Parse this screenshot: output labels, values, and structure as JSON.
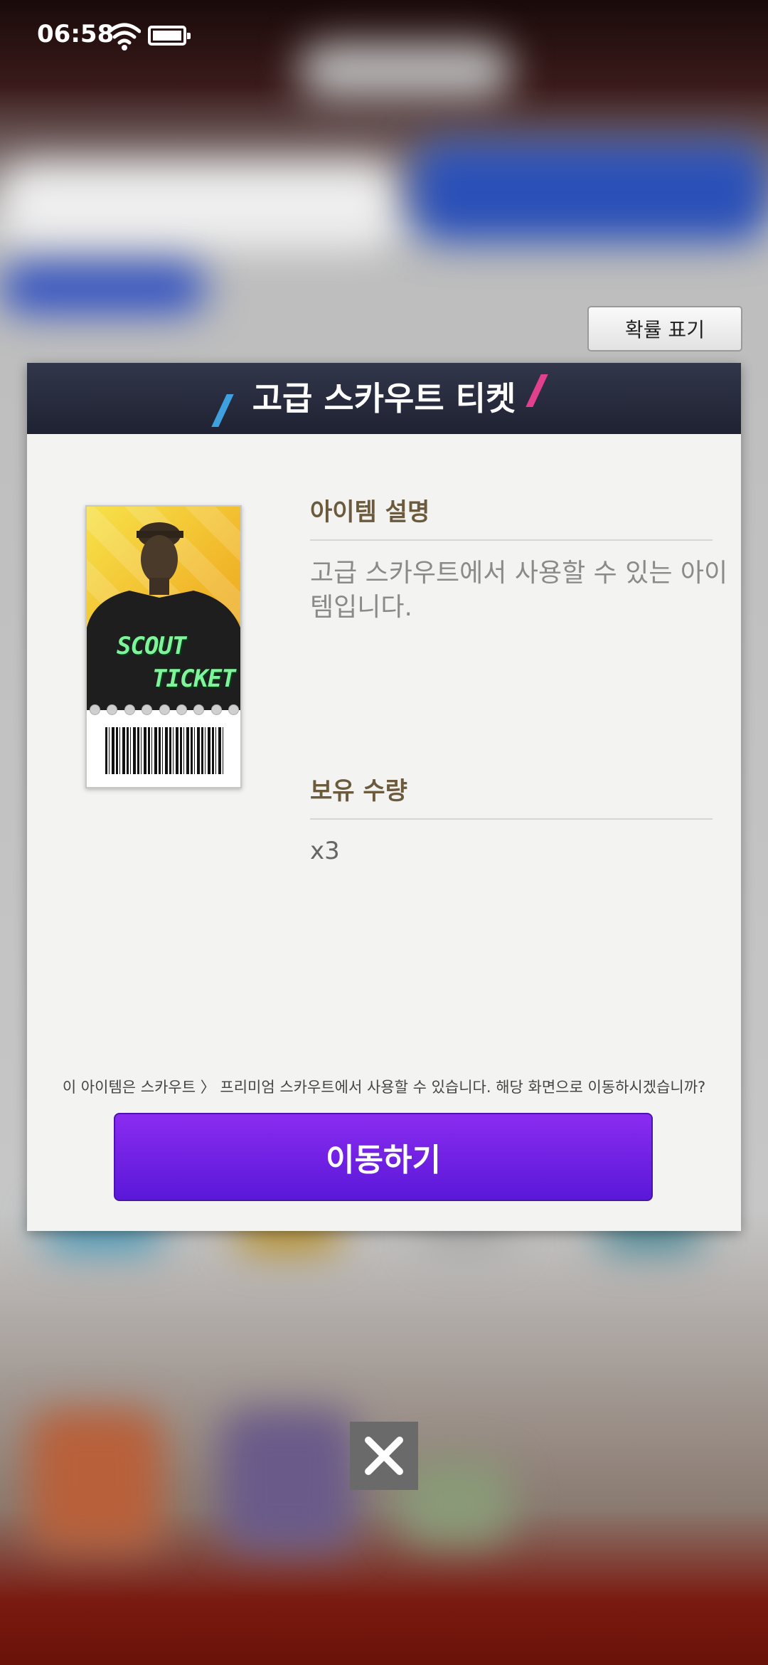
{
  "status_bar": {
    "time": "06:58"
  },
  "probability_button": {
    "label": "확률 표기"
  },
  "dialog": {
    "title": "고급 스카우트 티켓",
    "ticket_image": {
      "line1": "SCOUT",
      "line2": "TICKET"
    },
    "description_title": "아이템 설명",
    "description_text": "고급 스카우트에서 사용할 수 있는 아이템입니다.",
    "quantity_title": "보유 수량",
    "quantity_value": "x3",
    "notice": "이 아이템은 스카우트 〉 프리미엄 스카우트에서 사용할 수 있습니다. 해당 화면으로 이동하시겠습니까?",
    "move_button_label": "이동하기"
  },
  "icons": [
    "wifi-icon",
    "battery-icon",
    "close-icon"
  ],
  "colors": {
    "header": "#262a3c",
    "button_purple": "#7a24e8",
    "section_title": "#6b5a3c"
  }
}
